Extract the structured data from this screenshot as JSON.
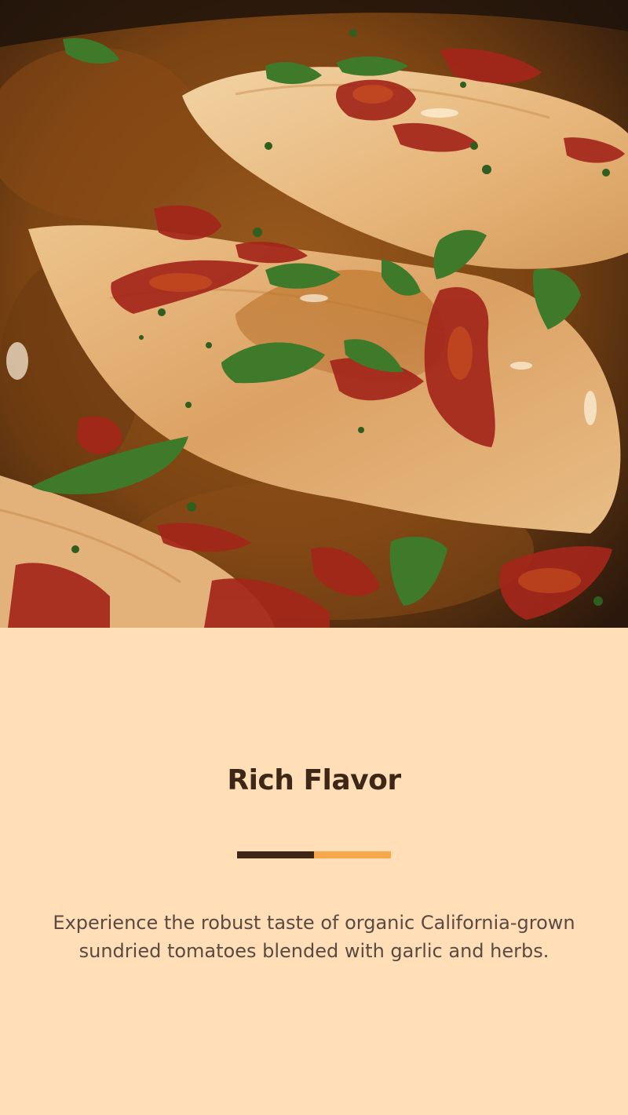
{
  "hero": {
    "alt": "Chicken breasts in a skillet with sundried tomato cream sauce and fresh basil"
  },
  "slide": {
    "title": "Rich Flavor",
    "description": "Experience the robust taste of organic California-grown sundried tomatoes blended with garlic and herbs.",
    "progress_fraction": 0.5
  },
  "colors": {
    "background": "#FFDEB8",
    "title": "#3D2817",
    "progress_done": "#3D2817",
    "progress_rest": "#F6A84B",
    "body_text": "#5B4A40"
  }
}
